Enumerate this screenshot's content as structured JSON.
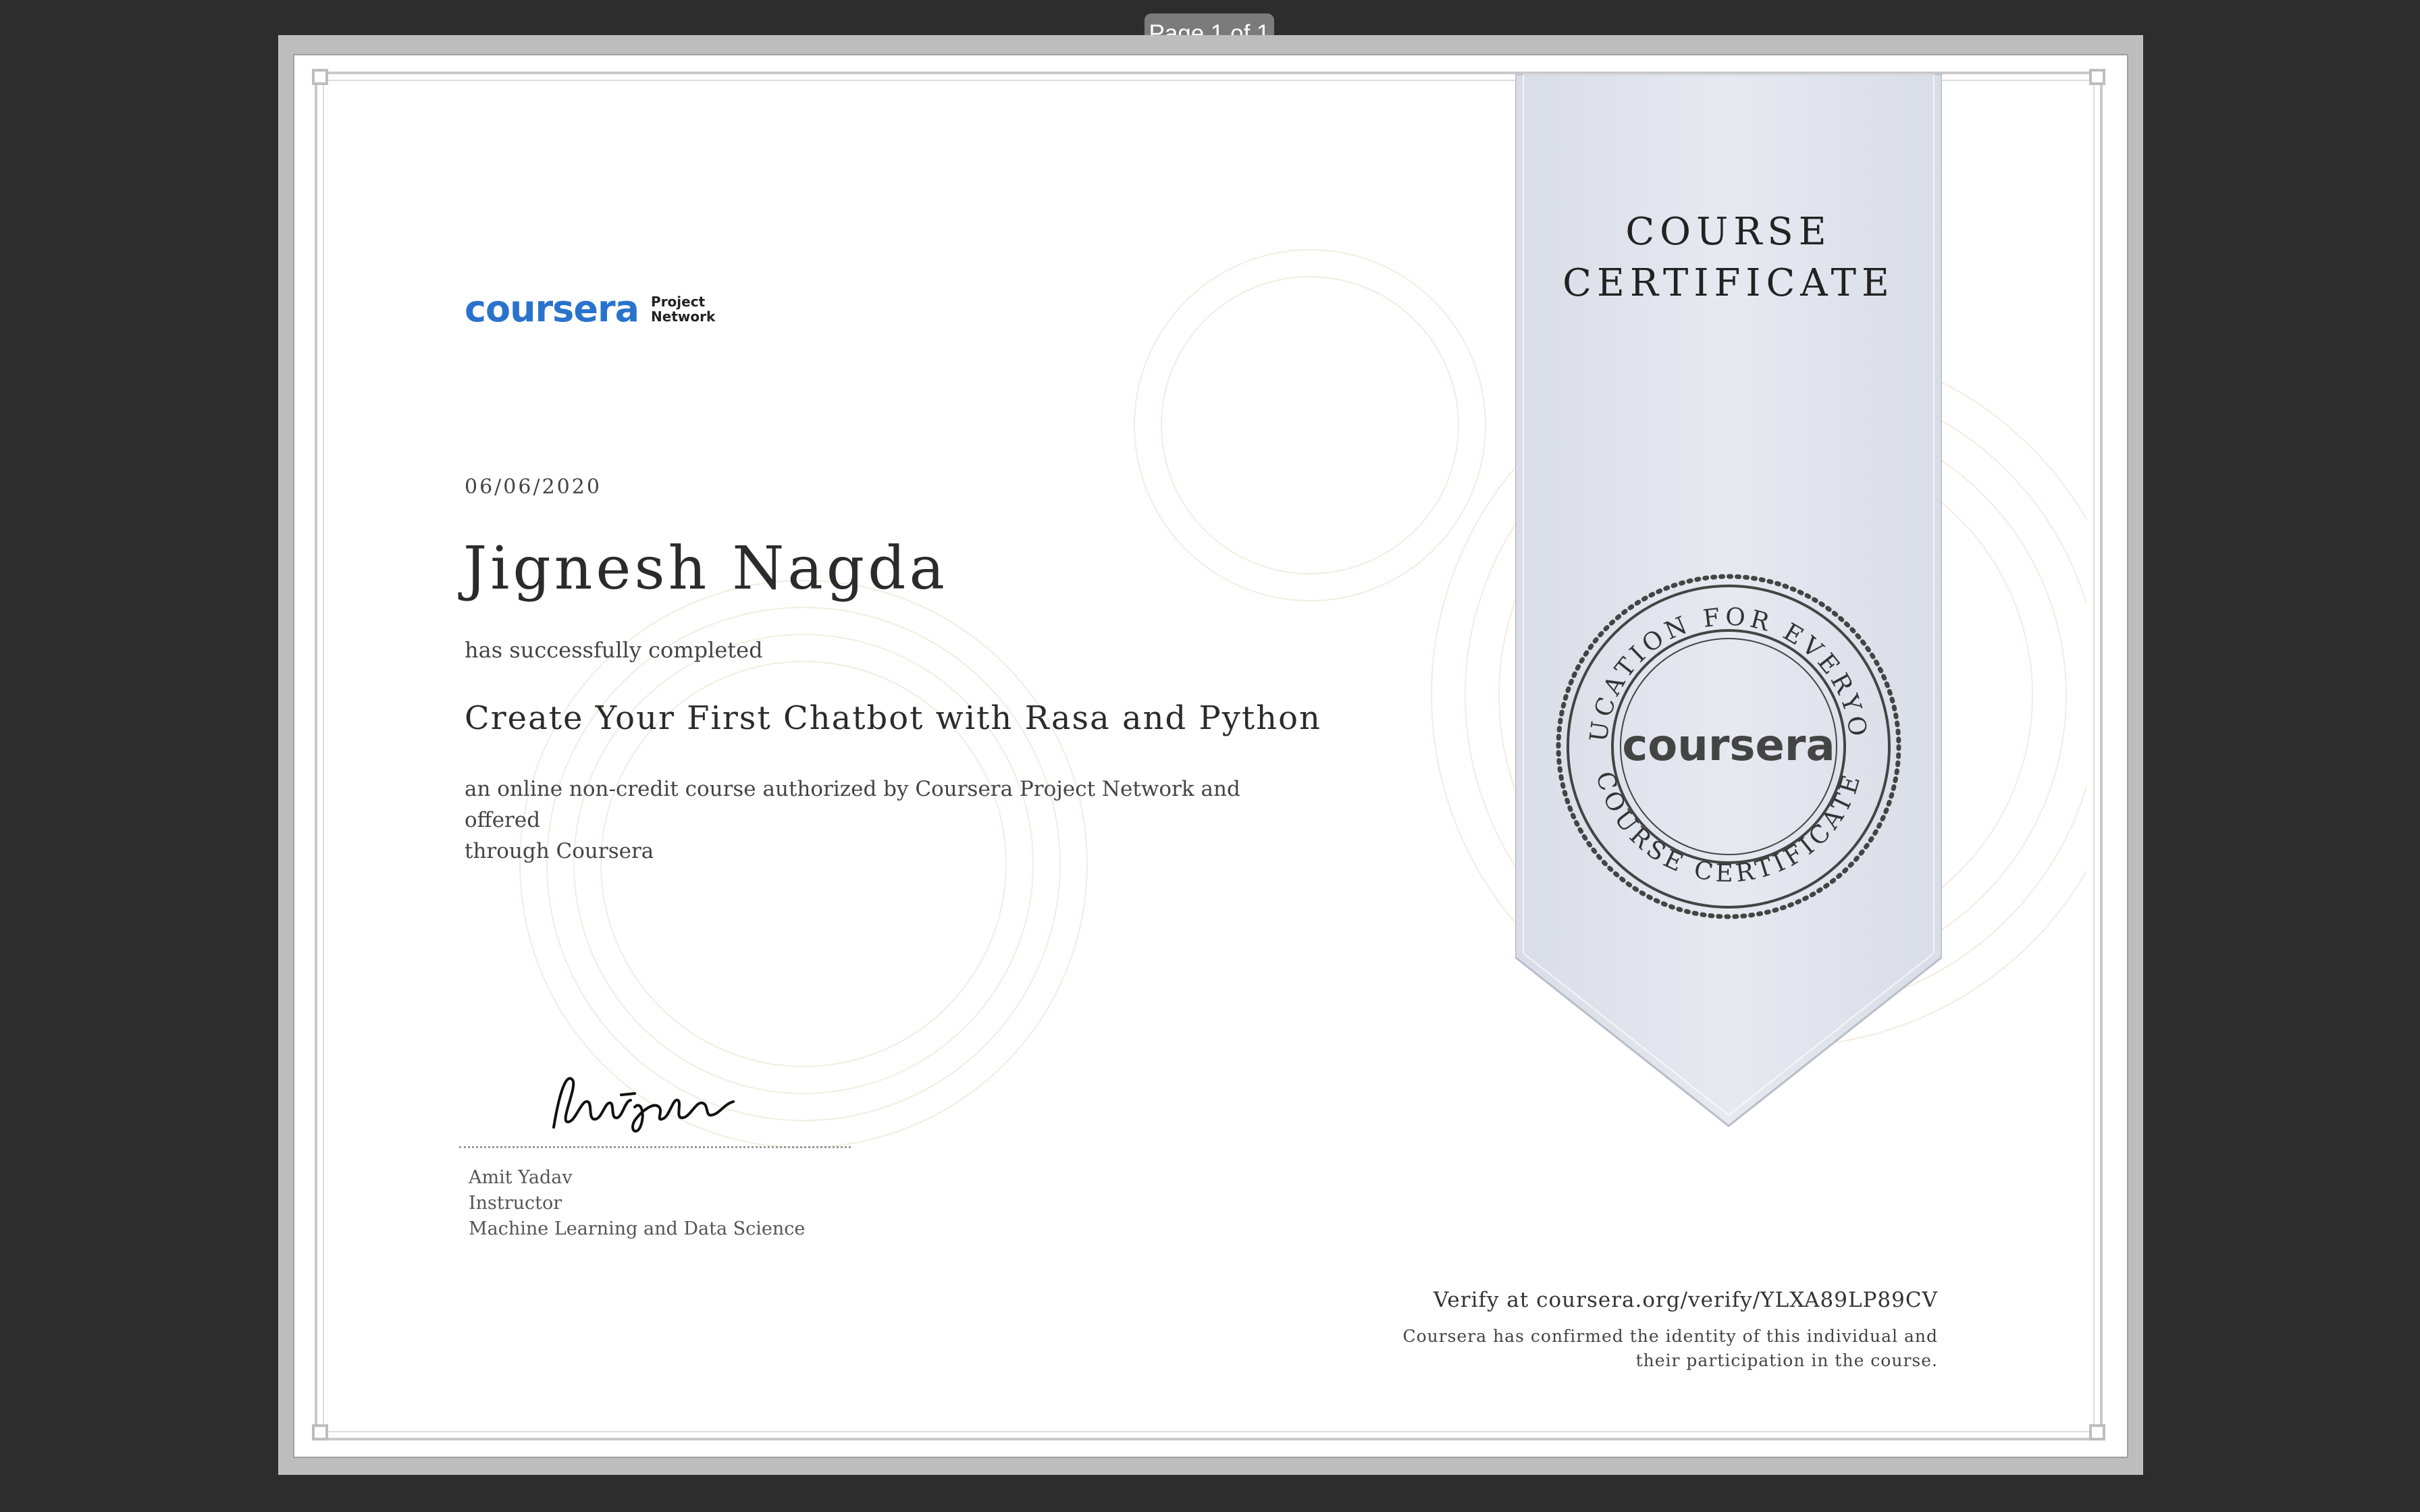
{
  "viewer": {
    "page_indicator": "Page 1 of 1"
  },
  "certificate": {
    "logo": {
      "wordmark": "coursera",
      "sub_line1": "Project",
      "sub_line2": "Network",
      "color": "#2a73cc"
    },
    "date": "06/06/2020",
    "recipient_name": "Jignesh Nagda",
    "completed_text": "has successfully completed",
    "course_title": "Create Your First Chatbot with Rasa and Python",
    "description_line1": "an online non-credit course authorized by Coursera Project Network and offered",
    "description_line2": "through Coursera",
    "ribbon": {
      "title_line1": "COURSE",
      "title_line2": "CERTIFICATE",
      "color": "#e3e6ee"
    },
    "seal": {
      "top_text": "EDUCATION FOR EVERYONE",
      "bottom_text": "COURSE CERTIFICATE",
      "center_text": "coursera"
    },
    "signature": {
      "signer_name": "Amit Yadav",
      "signer_role": "Instructor",
      "signer_org": "Machine Learning and Data Science"
    },
    "verify_text": "Verify at coursera.org/verify/YLXA89LP89CV",
    "confirm_line1": "Coursera has confirmed the identity of this individual and",
    "confirm_line2": "their participation in the course."
  }
}
